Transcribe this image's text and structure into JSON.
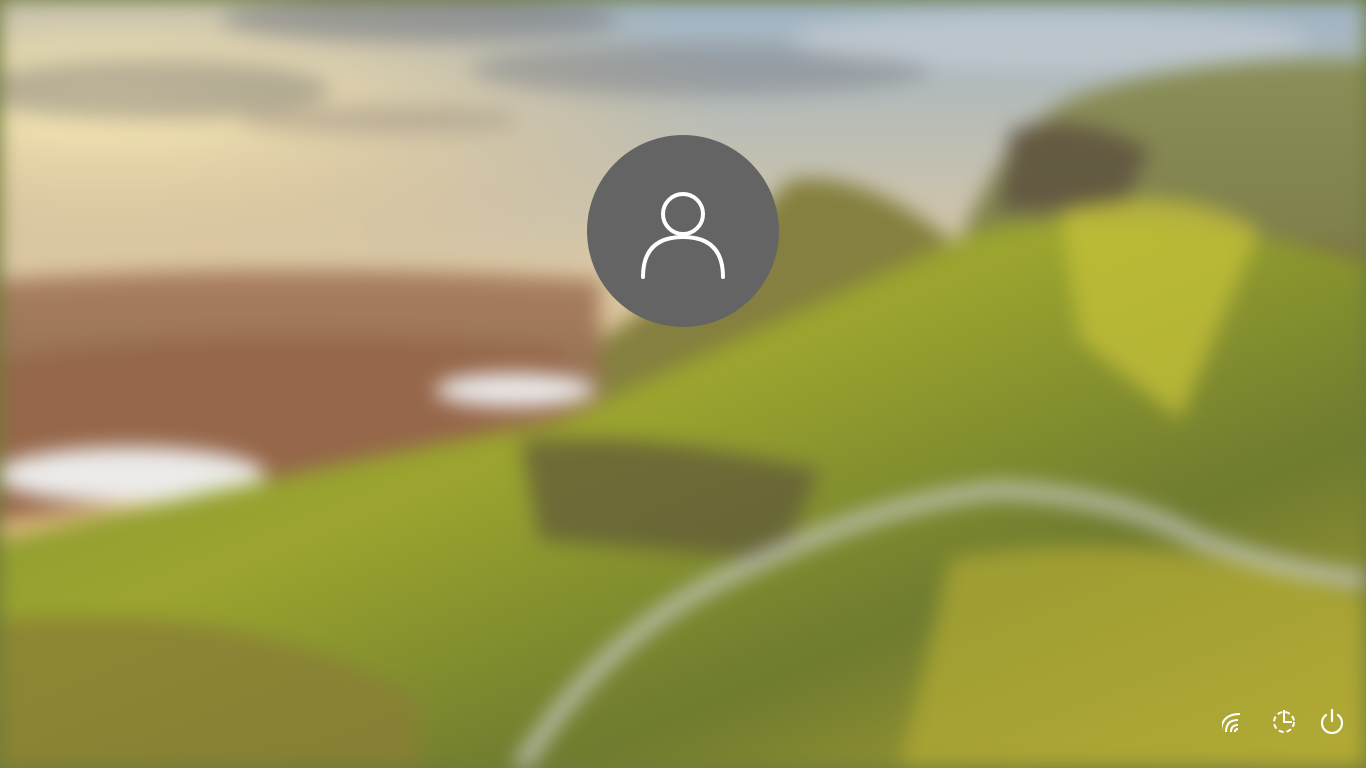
{
  "screen": {
    "type": "lock-screen-user-login"
  },
  "user": {
    "avatar_icon": "user-icon",
    "avatar_color": "#646464"
  },
  "tray": {
    "items": [
      {
        "icon": "network-wifi-icon"
      },
      {
        "icon": "ease-of-access-icon"
      },
      {
        "icon": "power-icon"
      }
    ]
  }
}
